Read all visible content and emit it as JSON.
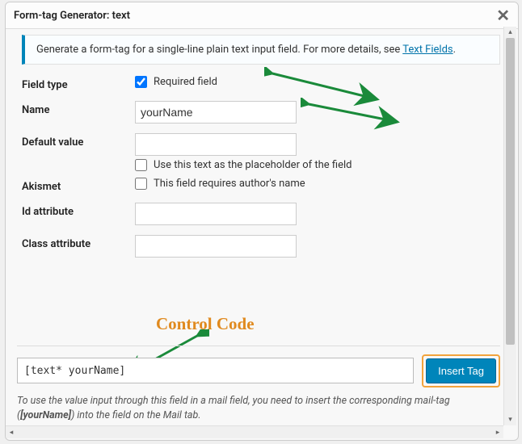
{
  "title": "Form-tag Generator: text",
  "banner": {
    "text_before_link": "Generate a form-tag for a single-line plain text input field. For more details, see ",
    "link_text": "Text Fields",
    "text_after_link": "."
  },
  "fields": {
    "field_type": {
      "label": "Field type",
      "required_label": "Required field",
      "required_checked": true
    },
    "name": {
      "label": "Name",
      "value": "yourName"
    },
    "default_value": {
      "label": "Default value",
      "value": "",
      "placeholder_opt": "Use this text as the placeholder of the field",
      "placeholder_checked": false
    },
    "akismet": {
      "label": "Akismet",
      "opt": "This field requires author's name",
      "checked": false
    },
    "id_attr": {
      "label": "Id attribute",
      "value": ""
    },
    "class_attr": {
      "label": "Class attribute",
      "value": ""
    }
  },
  "annotation": "Control Code",
  "footer": {
    "code": "[text* yourName]",
    "button": "Insert Tag",
    "hint_pre": "To use the value input through this field in a mail field, you need to insert the corresponding mail-tag (",
    "hint_bold": "[yourName]",
    "hint_post": ") into the field on the Mail tab."
  }
}
